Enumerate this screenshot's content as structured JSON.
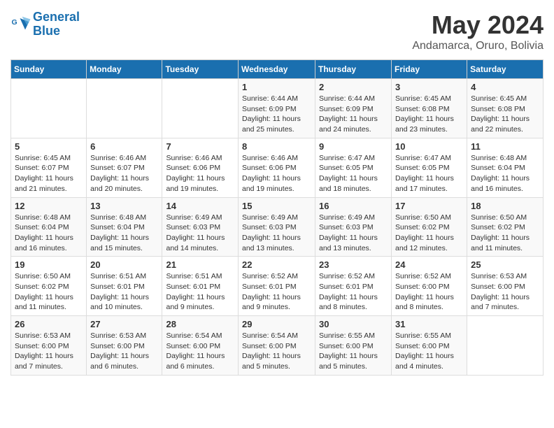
{
  "header": {
    "logo_line1": "General",
    "logo_line2": "Blue",
    "month": "May 2024",
    "location": "Andamarca, Oruro, Bolivia"
  },
  "weekdays": [
    "Sunday",
    "Monday",
    "Tuesday",
    "Wednesday",
    "Thursday",
    "Friday",
    "Saturday"
  ],
  "weeks": [
    [
      {
        "day": "",
        "info": ""
      },
      {
        "day": "",
        "info": ""
      },
      {
        "day": "",
        "info": ""
      },
      {
        "day": "1",
        "info": "Sunrise: 6:44 AM\nSunset: 6:09 PM\nDaylight: 11 hours and 25 minutes."
      },
      {
        "day": "2",
        "info": "Sunrise: 6:44 AM\nSunset: 6:09 PM\nDaylight: 11 hours and 24 minutes."
      },
      {
        "day": "3",
        "info": "Sunrise: 6:45 AM\nSunset: 6:08 PM\nDaylight: 11 hours and 23 minutes."
      },
      {
        "day": "4",
        "info": "Sunrise: 6:45 AM\nSunset: 6:08 PM\nDaylight: 11 hours and 22 minutes."
      }
    ],
    [
      {
        "day": "5",
        "info": "Sunrise: 6:45 AM\nSunset: 6:07 PM\nDaylight: 11 hours and 21 minutes."
      },
      {
        "day": "6",
        "info": "Sunrise: 6:46 AM\nSunset: 6:07 PM\nDaylight: 11 hours and 20 minutes."
      },
      {
        "day": "7",
        "info": "Sunrise: 6:46 AM\nSunset: 6:06 PM\nDaylight: 11 hours and 19 minutes."
      },
      {
        "day": "8",
        "info": "Sunrise: 6:46 AM\nSunset: 6:06 PM\nDaylight: 11 hours and 19 minutes."
      },
      {
        "day": "9",
        "info": "Sunrise: 6:47 AM\nSunset: 6:05 PM\nDaylight: 11 hours and 18 minutes."
      },
      {
        "day": "10",
        "info": "Sunrise: 6:47 AM\nSunset: 6:05 PM\nDaylight: 11 hours and 17 minutes."
      },
      {
        "day": "11",
        "info": "Sunrise: 6:48 AM\nSunset: 6:04 PM\nDaylight: 11 hours and 16 minutes."
      }
    ],
    [
      {
        "day": "12",
        "info": "Sunrise: 6:48 AM\nSunset: 6:04 PM\nDaylight: 11 hours and 16 minutes."
      },
      {
        "day": "13",
        "info": "Sunrise: 6:48 AM\nSunset: 6:04 PM\nDaylight: 11 hours and 15 minutes."
      },
      {
        "day": "14",
        "info": "Sunrise: 6:49 AM\nSunset: 6:03 PM\nDaylight: 11 hours and 14 minutes."
      },
      {
        "day": "15",
        "info": "Sunrise: 6:49 AM\nSunset: 6:03 PM\nDaylight: 11 hours and 13 minutes."
      },
      {
        "day": "16",
        "info": "Sunrise: 6:49 AM\nSunset: 6:03 PM\nDaylight: 11 hours and 13 minutes."
      },
      {
        "day": "17",
        "info": "Sunrise: 6:50 AM\nSunset: 6:02 PM\nDaylight: 11 hours and 12 minutes."
      },
      {
        "day": "18",
        "info": "Sunrise: 6:50 AM\nSunset: 6:02 PM\nDaylight: 11 hours and 11 minutes."
      }
    ],
    [
      {
        "day": "19",
        "info": "Sunrise: 6:50 AM\nSunset: 6:02 PM\nDaylight: 11 hours and 11 minutes."
      },
      {
        "day": "20",
        "info": "Sunrise: 6:51 AM\nSunset: 6:01 PM\nDaylight: 11 hours and 10 minutes."
      },
      {
        "day": "21",
        "info": "Sunrise: 6:51 AM\nSunset: 6:01 PM\nDaylight: 11 hours and 9 minutes."
      },
      {
        "day": "22",
        "info": "Sunrise: 6:52 AM\nSunset: 6:01 PM\nDaylight: 11 hours and 9 minutes."
      },
      {
        "day": "23",
        "info": "Sunrise: 6:52 AM\nSunset: 6:01 PM\nDaylight: 11 hours and 8 minutes."
      },
      {
        "day": "24",
        "info": "Sunrise: 6:52 AM\nSunset: 6:00 PM\nDaylight: 11 hours and 8 minutes."
      },
      {
        "day": "25",
        "info": "Sunrise: 6:53 AM\nSunset: 6:00 PM\nDaylight: 11 hours and 7 minutes."
      }
    ],
    [
      {
        "day": "26",
        "info": "Sunrise: 6:53 AM\nSunset: 6:00 PM\nDaylight: 11 hours and 7 minutes."
      },
      {
        "day": "27",
        "info": "Sunrise: 6:53 AM\nSunset: 6:00 PM\nDaylight: 11 hours and 6 minutes."
      },
      {
        "day": "28",
        "info": "Sunrise: 6:54 AM\nSunset: 6:00 PM\nDaylight: 11 hours and 6 minutes."
      },
      {
        "day": "29",
        "info": "Sunrise: 6:54 AM\nSunset: 6:00 PM\nDaylight: 11 hours and 5 minutes."
      },
      {
        "day": "30",
        "info": "Sunrise: 6:55 AM\nSunset: 6:00 PM\nDaylight: 11 hours and 5 minutes."
      },
      {
        "day": "31",
        "info": "Sunrise: 6:55 AM\nSunset: 6:00 PM\nDaylight: 11 hours and 4 minutes."
      },
      {
        "day": "",
        "info": ""
      }
    ]
  ]
}
